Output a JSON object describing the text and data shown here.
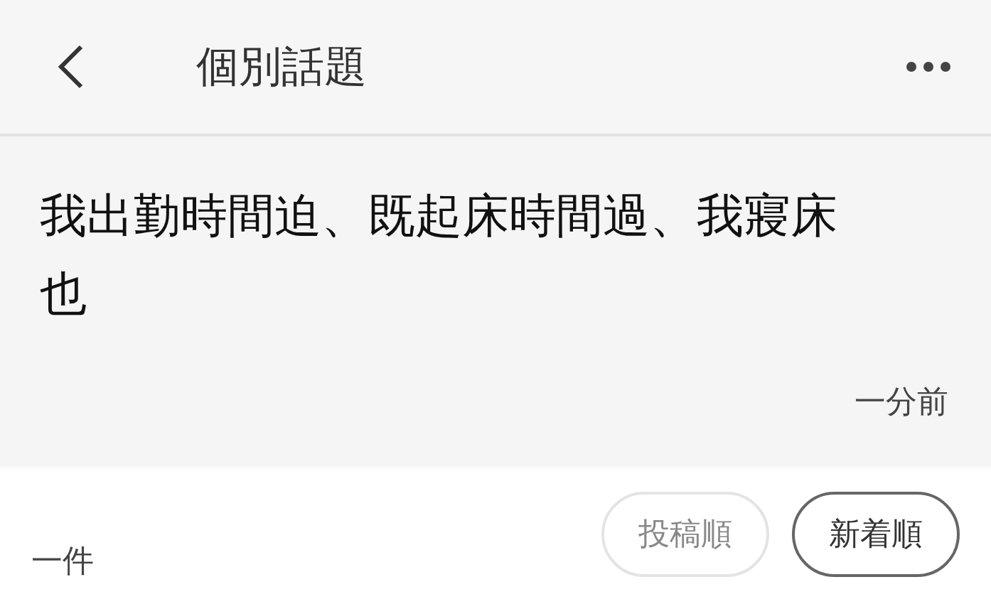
{
  "header": {
    "title": "個別話題"
  },
  "post": {
    "text": "我出勤時間迫、既起床時間過、我寢床也",
    "time": "一分前"
  },
  "footer": {
    "count": "一件",
    "sort_options": [
      {
        "label": "投稿順",
        "selected": false
      },
      {
        "label": "新着順",
        "selected": true
      }
    ]
  }
}
